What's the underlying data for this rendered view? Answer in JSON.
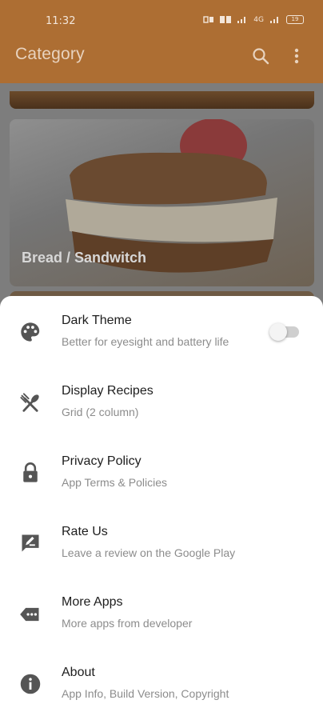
{
  "status": {
    "time": "11:32",
    "network": "4G",
    "battery": "19"
  },
  "appbar": {
    "title": "Category",
    "search_icon": "search-icon",
    "menu_icon": "more-vert-icon"
  },
  "content": {
    "card_label": "Bread / Sandwitch"
  },
  "sheet": {
    "items": [
      {
        "title": "Dark Theme",
        "subtitle": "Better for eyesight and battery life",
        "icon": "palette-icon",
        "toggle": false
      },
      {
        "title": "Display Recipes",
        "subtitle": "Grid (2 column)",
        "icon": "utensils-icon"
      },
      {
        "title": "Privacy Policy",
        "subtitle": "App Terms & Policies",
        "icon": "lock-icon"
      },
      {
        "title": "Rate Us",
        "subtitle": "Leave a review on the Google Play",
        "icon": "rate-review-icon"
      },
      {
        "title": "More Apps",
        "subtitle": "More apps from developer",
        "icon": "more-apps-icon"
      },
      {
        "title": "About",
        "subtitle": "App Info, Build Version, Copyright",
        "icon": "info-icon"
      }
    ]
  },
  "colors": {
    "app_bar": "#AD6E33",
    "sheet": "#FFFFFF",
    "icon": "#555555"
  }
}
